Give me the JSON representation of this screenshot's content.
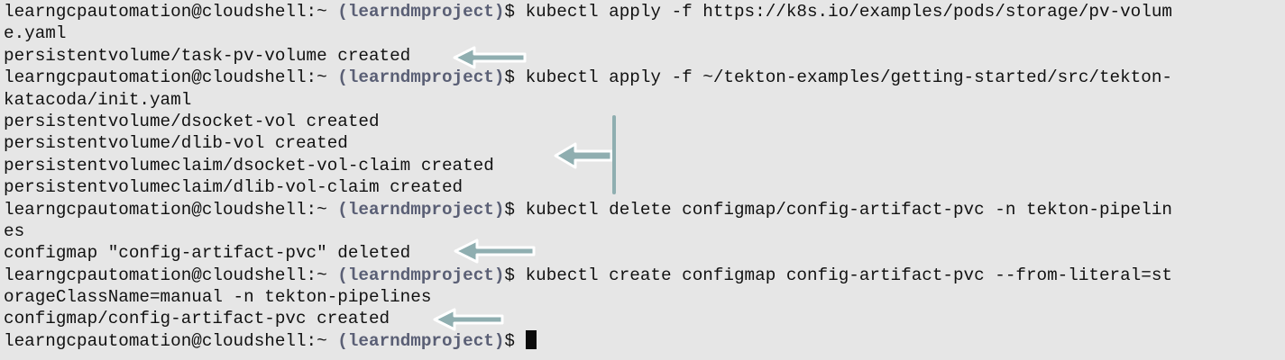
{
  "terminal": {
    "prompt": {
      "user_host": "learngcpautomation@cloudshell:~",
      "project": "(learndmproject)",
      "sign": "$"
    },
    "lines": [
      {
        "kind": "prompt",
        "command": "kubectl apply -f https://k8s.io/examples/pods/storage/pv-volum"
      },
      {
        "kind": "output",
        "text": "e.yaml"
      },
      {
        "kind": "output",
        "text": "persistentvolume/task-pv-volume created"
      },
      {
        "kind": "prompt",
        "command": "kubectl apply -f ~/tekton-examples/getting-started/src/tekton-"
      },
      {
        "kind": "output",
        "text": "katacoda/init.yaml"
      },
      {
        "kind": "output",
        "text": "persistentvolume/dsocket-vol created"
      },
      {
        "kind": "output",
        "text": "persistentvolume/dlib-vol created"
      },
      {
        "kind": "output",
        "text": "persistentvolumeclaim/dsocket-vol-claim created"
      },
      {
        "kind": "output",
        "text": "persistentvolumeclaim/dlib-vol-claim created"
      },
      {
        "kind": "prompt",
        "command": "kubectl delete configmap/config-artifact-pvc -n tekton-pipelin"
      },
      {
        "kind": "output",
        "text": "es"
      },
      {
        "kind": "output",
        "text": "configmap \"config-artifact-pvc\" deleted"
      },
      {
        "kind": "prompt",
        "command": "kubectl create configmap config-artifact-pvc --from-literal=st"
      },
      {
        "kind": "output",
        "text": "orageClassName=manual -n tekton-pipelines"
      },
      {
        "kind": "output",
        "text": "configmap/config-artifact-pvc created"
      },
      {
        "kind": "prompt",
        "command": "",
        "cursor": true
      }
    ]
  },
  "annotations": {
    "arrow_icon": "left-arrow-icon",
    "arrow_color": "#8faeb0",
    "arrow_outline": "#ffffff"
  },
  "colors": {
    "background": "#e6e6e6",
    "text": "#111111",
    "project": "#5a5f75"
  }
}
